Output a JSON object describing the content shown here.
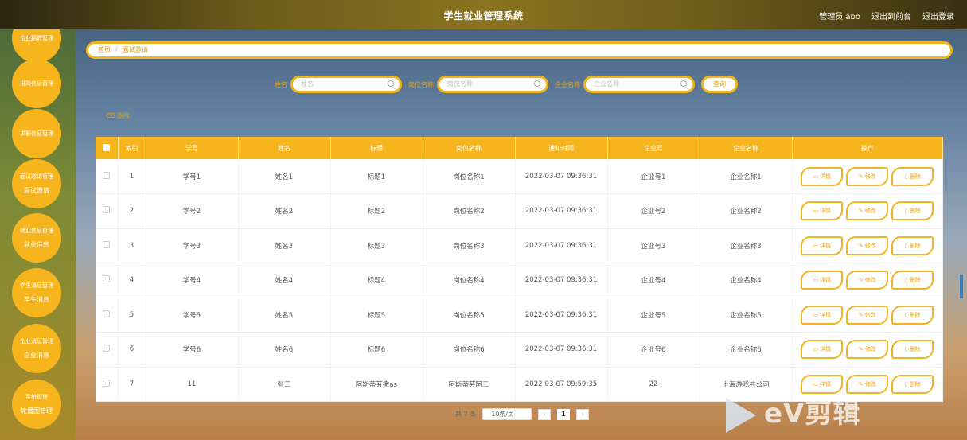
{
  "header": {
    "title": "学生就业管理系统",
    "user": "管理员 abo",
    "front": "退出到前台",
    "logout": "退出登录"
  },
  "sidebar": {
    "items": [
      {
        "label": "企业招聘管理",
        "sub": ""
      },
      {
        "label": "投简信息管理",
        "sub": ""
      },
      {
        "label": "求职信息管理",
        "sub": ""
      },
      {
        "label": "面试邀请管理",
        "sub": "面试邀请"
      },
      {
        "label": "就业信息管理",
        "sub": "就业信息"
      },
      {
        "label": "学生消息管理",
        "sub": "学生消息"
      },
      {
        "label": "企业消息管理",
        "sub": "企业消息"
      },
      {
        "label": "系统管理",
        "sub": "轮播图管理"
      }
    ]
  },
  "breadcrumb": {
    "home": "首页",
    "current": "面试邀请"
  },
  "search": {
    "name_label": "姓名",
    "name_placeholder": "姓名",
    "post_label": "岗位名称",
    "post_placeholder": "岗位名称",
    "company_label": "企业名称",
    "company_placeholder": "企业名称",
    "query": "查询"
  },
  "toolbar": {
    "delete": "删除"
  },
  "table": {
    "headers": [
      "索引",
      "学号",
      "姓名",
      "标题",
      "岗位名称",
      "通知时间",
      "企业号",
      "企业名称",
      "操作"
    ],
    "rows": [
      [
        "1",
        "学号1",
        "姓名1",
        "标题1",
        "岗位名称1",
        "2022-03-07 09:36:31",
        "企业号1",
        "企业名称1"
      ],
      [
        "2",
        "学号2",
        "姓名2",
        "标题2",
        "岗位名称2",
        "2022-03-07 09:36:31",
        "企业号2",
        "企业名称2"
      ],
      [
        "3",
        "学号3",
        "姓名3",
        "标题3",
        "岗位名称3",
        "2022-03-07 09:36:31",
        "企业号3",
        "企业名称3"
      ],
      [
        "4",
        "学号4",
        "姓名4",
        "标题4",
        "岗位名称4",
        "2022-03-07 09:36:31",
        "企业号4",
        "企业名称4"
      ],
      [
        "5",
        "学号5",
        "姓名5",
        "标题5",
        "岗位名称5",
        "2022-03-07 09:36:31",
        "企业号5",
        "企业名称5"
      ],
      [
        "6",
        "学号6",
        "姓名6",
        "标题6",
        "岗位名称6",
        "2022-03-07 09:36:31",
        "企业号6",
        "企业名称6"
      ],
      [
        "7",
        "11",
        "张三",
        "阿斯蒂芬撒as",
        "阿斯蒂芬阿三",
        "2022-03-07 09:59:35",
        "22",
        "上海游戏共公司"
      ]
    ],
    "actions": {
      "detail": "详情",
      "edit": "修改",
      "delete": "删除"
    }
  },
  "pager": {
    "total": "共 7 条",
    "size": "10条/页",
    "page": "1"
  },
  "watermark": "eV剪辑"
}
